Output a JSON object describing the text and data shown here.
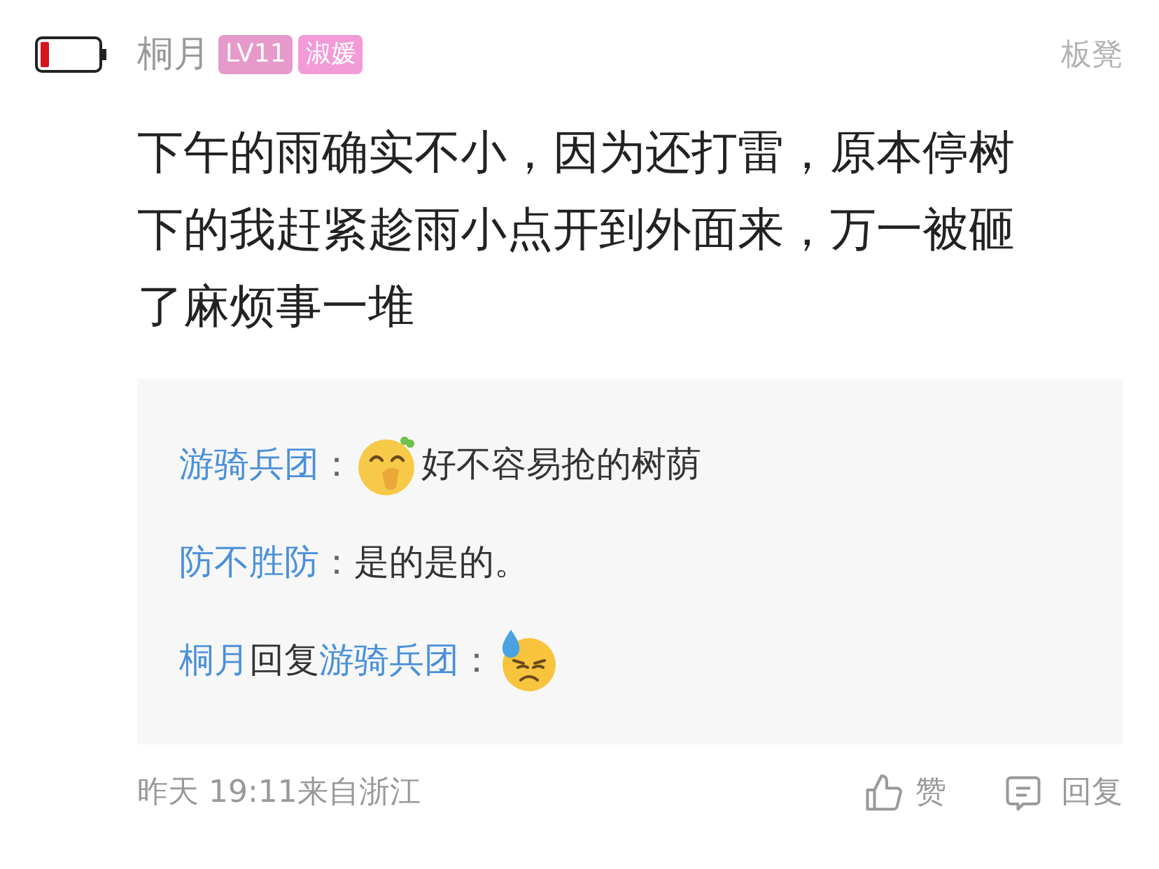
{
  "comment": {
    "author": "桐月",
    "badges": [
      {
        "label": "LV11",
        "color": "#e59acb"
      },
      {
        "label": "淑媛",
        "color": "#f29bd8"
      }
    ],
    "floor": "板凳",
    "text": "下午的雨确实不小，因为还打雷，原本停树下的我赶紧趁雨小点开到外面来，万一被砸了麻烦事一堆",
    "replies": [
      {
        "author": "游骑兵团",
        "separator": "：",
        "parts": [
          {
            "kind": "face_hand"
          },
          {
            "kind": "text",
            "text": "好不容易抢的树荫"
          }
        ]
      },
      {
        "author": "防不胜防",
        "separator": "：",
        "parts": [
          {
            "kind": "text",
            "text": "是的是的。"
          }
        ]
      },
      {
        "author": "桐月",
        "reply_word": "回复",
        "reply_to": "游骑兵团",
        "separator": "：",
        "parts": [
          {
            "kind": "face_sweat"
          }
        ]
      }
    ],
    "time": "昨天 19:11来自浙江",
    "like_label": "赞",
    "reply_label": "回复"
  }
}
